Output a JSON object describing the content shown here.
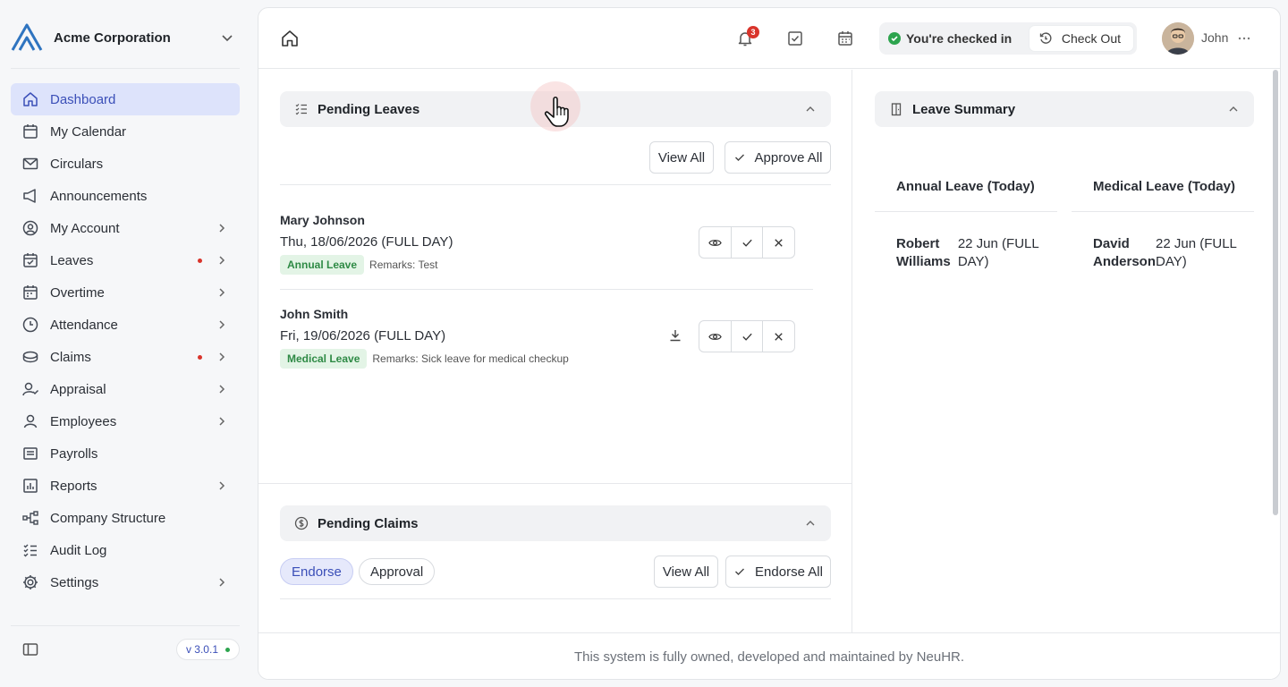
{
  "org": {
    "name": "Acme Corporation"
  },
  "sidebar": {
    "items": [
      {
        "label": "Dashboard"
      },
      {
        "label": "My Calendar"
      },
      {
        "label": "Circulars"
      },
      {
        "label": "Announcements"
      },
      {
        "label": "My Account"
      },
      {
        "label": "Leaves"
      },
      {
        "label": "Overtime"
      },
      {
        "label": "Attendance"
      },
      {
        "label": "Claims"
      },
      {
        "label": "Appraisal"
      },
      {
        "label": "Employees"
      },
      {
        "label": "Payrolls"
      },
      {
        "label": "Reports"
      },
      {
        "label": "Company Structure"
      },
      {
        "label": "Audit Log"
      },
      {
        "label": "Settings"
      }
    ],
    "version": "v 3.0.1"
  },
  "topbar": {
    "notification_count": "3",
    "checkin_status": "You're checked in",
    "checkout_label": "Check Out",
    "user_name": "John"
  },
  "pending_leaves": {
    "title": "Pending Leaves",
    "view_all": "View All",
    "approve_all": "Approve All",
    "items": [
      {
        "name": "Mary Johnson",
        "date": "Thu, 18/06/2026 (FULL DAY)",
        "type": "Annual Leave",
        "remarks": "Remarks: Test"
      },
      {
        "name": "John Smith",
        "date": "Fri, 19/06/2026 (FULL DAY)",
        "type": "Medical Leave",
        "remarks": "Remarks: Sick leave for medical checkup"
      }
    ]
  },
  "pending_claims": {
    "title": "Pending Claims",
    "tabs": [
      "Endorse",
      "Approval"
    ],
    "view_all": "View All",
    "endorse_all": "Endorse All"
  },
  "leave_summary": {
    "title": "Leave Summary",
    "columns": [
      {
        "heading": "Annual Leave (Today)",
        "person": "Robert Williams",
        "when": "22 Jun (FULL DAY)"
      },
      {
        "heading": "Medical Leave (Today)",
        "person": "David Anderson",
        "when": "22 Jun (FULL DAY)"
      }
    ]
  },
  "footer": {
    "text": "This system is fully owned, developed and maintained by NeuHR."
  }
}
